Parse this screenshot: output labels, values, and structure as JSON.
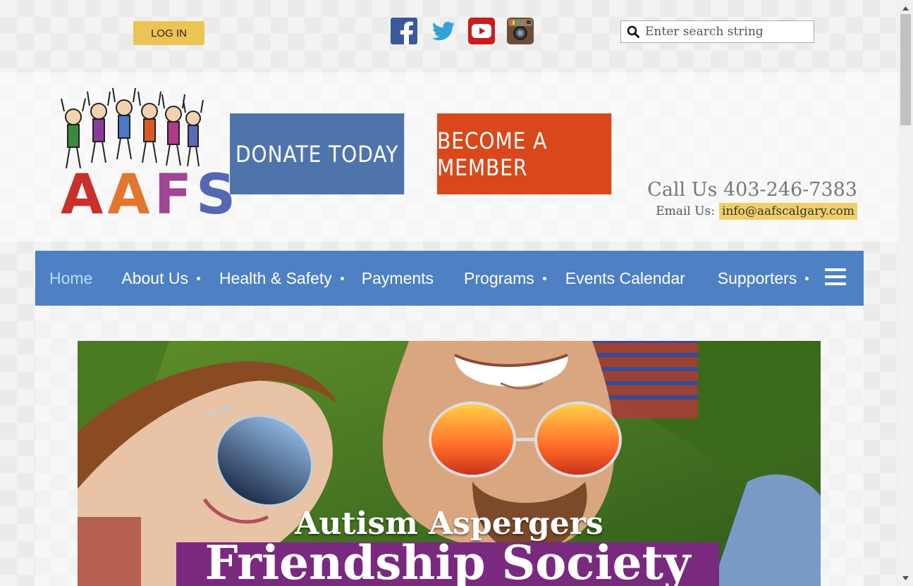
{
  "header": {
    "login_label": "LOG IN",
    "search_placeholder": "Enter search string",
    "social": [
      "facebook-icon",
      "twitter-icon",
      "youtube-icon",
      "instagram-icon"
    ],
    "logo_text": [
      "A",
      "A",
      "F",
      "S"
    ],
    "donate_label": "DONATE TODAY",
    "member_label": "BECOME A MEMBER",
    "call_text": "Call Us 403-246-7383",
    "email_label": "Email Us:",
    "email_address": "info@aafscalgary.com"
  },
  "nav": {
    "items": [
      {
        "label": "Home",
        "active": true,
        "submenu": false
      },
      {
        "label": "About Us",
        "active": false,
        "submenu": true
      },
      {
        "label": "Health & Safety",
        "active": false,
        "submenu": true
      },
      {
        "label": "Payments",
        "active": false,
        "submenu": false
      },
      {
        "label": "Programs",
        "active": false,
        "submenu": true
      },
      {
        "label": "Events Calendar",
        "active": false,
        "submenu": false
      },
      {
        "label": "Supporters",
        "active": false,
        "submenu": true
      }
    ]
  },
  "banner": {
    "subtitle": "Autism Aspergers",
    "title": "Friendship Society"
  },
  "colors": {
    "nav_bg": "#4e80c4",
    "donate_bg": "#4f74ac",
    "member_bg": "#d9481a",
    "login_bg": "#ecc455",
    "banner_band": "#7a2a7e"
  }
}
